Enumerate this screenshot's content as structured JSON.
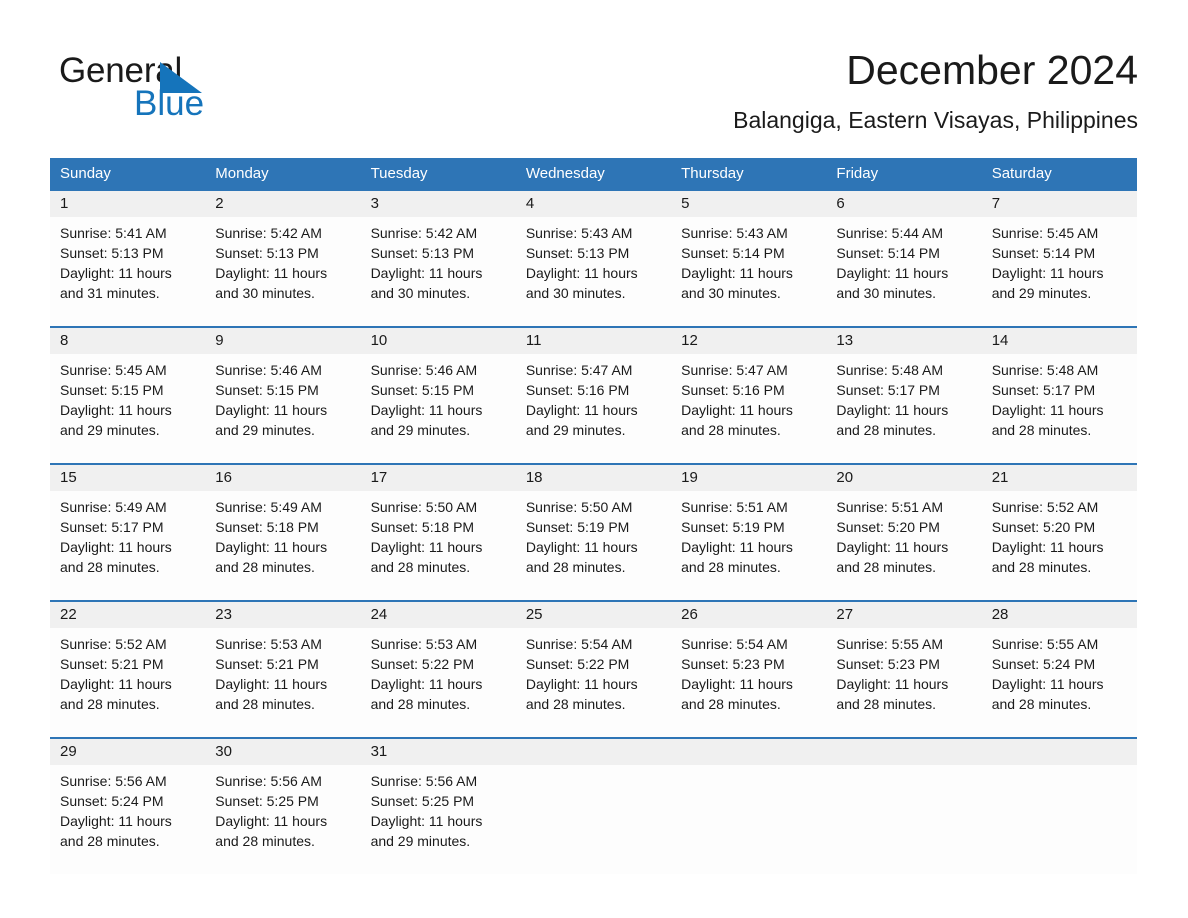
{
  "brand": {
    "word_one": "General",
    "word_two": "Blue",
    "triangle_icon": "brand-triangle-icon",
    "colors": {
      "black": "#1a1a1a",
      "blue": "#1574bb"
    }
  },
  "header": {
    "title": "December 2024",
    "subtitle": "Balangiga, Eastern Visayas, Philippines"
  },
  "calendar": {
    "accent_color": "#2e75b6",
    "date_band_color": "#f0f0f0",
    "weekdays": [
      "Sunday",
      "Monday",
      "Tuesday",
      "Wednesday",
      "Thursday",
      "Friday",
      "Saturday"
    ],
    "weeks": [
      [
        {
          "date": "1",
          "sunrise": "Sunrise: 5:41 AM",
          "sunset": "Sunset: 5:13 PM",
          "daylight": "Daylight: 11 hours and 31 minutes."
        },
        {
          "date": "2",
          "sunrise": "Sunrise: 5:42 AM",
          "sunset": "Sunset: 5:13 PM",
          "daylight": "Daylight: 11 hours and 30 minutes."
        },
        {
          "date": "3",
          "sunrise": "Sunrise: 5:42 AM",
          "sunset": "Sunset: 5:13 PM",
          "daylight": "Daylight: 11 hours and 30 minutes."
        },
        {
          "date": "4",
          "sunrise": "Sunrise: 5:43 AM",
          "sunset": "Sunset: 5:13 PM",
          "daylight": "Daylight: 11 hours and 30 minutes."
        },
        {
          "date": "5",
          "sunrise": "Sunrise: 5:43 AM",
          "sunset": "Sunset: 5:14 PM",
          "daylight": "Daylight: 11 hours and 30 minutes."
        },
        {
          "date": "6",
          "sunrise": "Sunrise: 5:44 AM",
          "sunset": "Sunset: 5:14 PM",
          "daylight": "Daylight: 11 hours and 30 minutes."
        },
        {
          "date": "7",
          "sunrise": "Sunrise: 5:45 AM",
          "sunset": "Sunset: 5:14 PM",
          "daylight": "Daylight: 11 hours and 29 minutes."
        }
      ],
      [
        {
          "date": "8",
          "sunrise": "Sunrise: 5:45 AM",
          "sunset": "Sunset: 5:15 PM",
          "daylight": "Daylight: 11 hours and 29 minutes."
        },
        {
          "date": "9",
          "sunrise": "Sunrise: 5:46 AM",
          "sunset": "Sunset: 5:15 PM",
          "daylight": "Daylight: 11 hours and 29 minutes."
        },
        {
          "date": "10",
          "sunrise": "Sunrise: 5:46 AM",
          "sunset": "Sunset: 5:15 PM",
          "daylight": "Daylight: 11 hours and 29 minutes."
        },
        {
          "date": "11",
          "sunrise": "Sunrise: 5:47 AM",
          "sunset": "Sunset: 5:16 PM",
          "daylight": "Daylight: 11 hours and 29 minutes."
        },
        {
          "date": "12",
          "sunrise": "Sunrise: 5:47 AM",
          "sunset": "Sunset: 5:16 PM",
          "daylight": "Daylight: 11 hours and 28 minutes."
        },
        {
          "date": "13",
          "sunrise": "Sunrise: 5:48 AM",
          "sunset": "Sunset: 5:17 PM",
          "daylight": "Daylight: 11 hours and 28 minutes."
        },
        {
          "date": "14",
          "sunrise": "Sunrise: 5:48 AM",
          "sunset": "Sunset: 5:17 PM",
          "daylight": "Daylight: 11 hours and 28 minutes."
        }
      ],
      [
        {
          "date": "15",
          "sunrise": "Sunrise: 5:49 AM",
          "sunset": "Sunset: 5:17 PM",
          "daylight": "Daylight: 11 hours and 28 minutes."
        },
        {
          "date": "16",
          "sunrise": "Sunrise: 5:49 AM",
          "sunset": "Sunset: 5:18 PM",
          "daylight": "Daylight: 11 hours and 28 minutes."
        },
        {
          "date": "17",
          "sunrise": "Sunrise: 5:50 AM",
          "sunset": "Sunset: 5:18 PM",
          "daylight": "Daylight: 11 hours and 28 minutes."
        },
        {
          "date": "18",
          "sunrise": "Sunrise: 5:50 AM",
          "sunset": "Sunset: 5:19 PM",
          "daylight": "Daylight: 11 hours and 28 minutes."
        },
        {
          "date": "19",
          "sunrise": "Sunrise: 5:51 AM",
          "sunset": "Sunset: 5:19 PM",
          "daylight": "Daylight: 11 hours and 28 minutes."
        },
        {
          "date": "20",
          "sunrise": "Sunrise: 5:51 AM",
          "sunset": "Sunset: 5:20 PM",
          "daylight": "Daylight: 11 hours and 28 minutes."
        },
        {
          "date": "21",
          "sunrise": "Sunrise: 5:52 AM",
          "sunset": "Sunset: 5:20 PM",
          "daylight": "Daylight: 11 hours and 28 minutes."
        }
      ],
      [
        {
          "date": "22",
          "sunrise": "Sunrise: 5:52 AM",
          "sunset": "Sunset: 5:21 PM",
          "daylight": "Daylight: 11 hours and 28 minutes."
        },
        {
          "date": "23",
          "sunrise": "Sunrise: 5:53 AM",
          "sunset": "Sunset: 5:21 PM",
          "daylight": "Daylight: 11 hours and 28 minutes."
        },
        {
          "date": "24",
          "sunrise": "Sunrise: 5:53 AM",
          "sunset": "Sunset: 5:22 PM",
          "daylight": "Daylight: 11 hours and 28 minutes."
        },
        {
          "date": "25",
          "sunrise": "Sunrise: 5:54 AM",
          "sunset": "Sunset: 5:22 PM",
          "daylight": "Daylight: 11 hours and 28 minutes."
        },
        {
          "date": "26",
          "sunrise": "Sunrise: 5:54 AM",
          "sunset": "Sunset: 5:23 PM",
          "daylight": "Daylight: 11 hours and 28 minutes."
        },
        {
          "date": "27",
          "sunrise": "Sunrise: 5:55 AM",
          "sunset": "Sunset: 5:23 PM",
          "daylight": "Daylight: 11 hours and 28 minutes."
        },
        {
          "date": "28",
          "sunrise": "Sunrise: 5:55 AM",
          "sunset": "Sunset: 5:24 PM",
          "daylight": "Daylight: 11 hours and 28 minutes."
        }
      ],
      [
        {
          "date": "29",
          "sunrise": "Sunrise: 5:56 AM",
          "sunset": "Sunset: 5:24 PM",
          "daylight": "Daylight: 11 hours and 28 minutes."
        },
        {
          "date": "30",
          "sunrise": "Sunrise: 5:56 AM",
          "sunset": "Sunset: 5:25 PM",
          "daylight": "Daylight: 11 hours and 28 minutes."
        },
        {
          "date": "31",
          "sunrise": "Sunrise: 5:56 AM",
          "sunset": "Sunset: 5:25 PM",
          "daylight": "Daylight: 11 hours and 29 minutes."
        },
        {
          "date": "",
          "sunrise": "",
          "sunset": "",
          "daylight": ""
        },
        {
          "date": "",
          "sunrise": "",
          "sunset": "",
          "daylight": ""
        },
        {
          "date": "",
          "sunrise": "",
          "sunset": "",
          "daylight": ""
        },
        {
          "date": "",
          "sunrise": "",
          "sunset": "",
          "daylight": ""
        }
      ]
    ]
  }
}
